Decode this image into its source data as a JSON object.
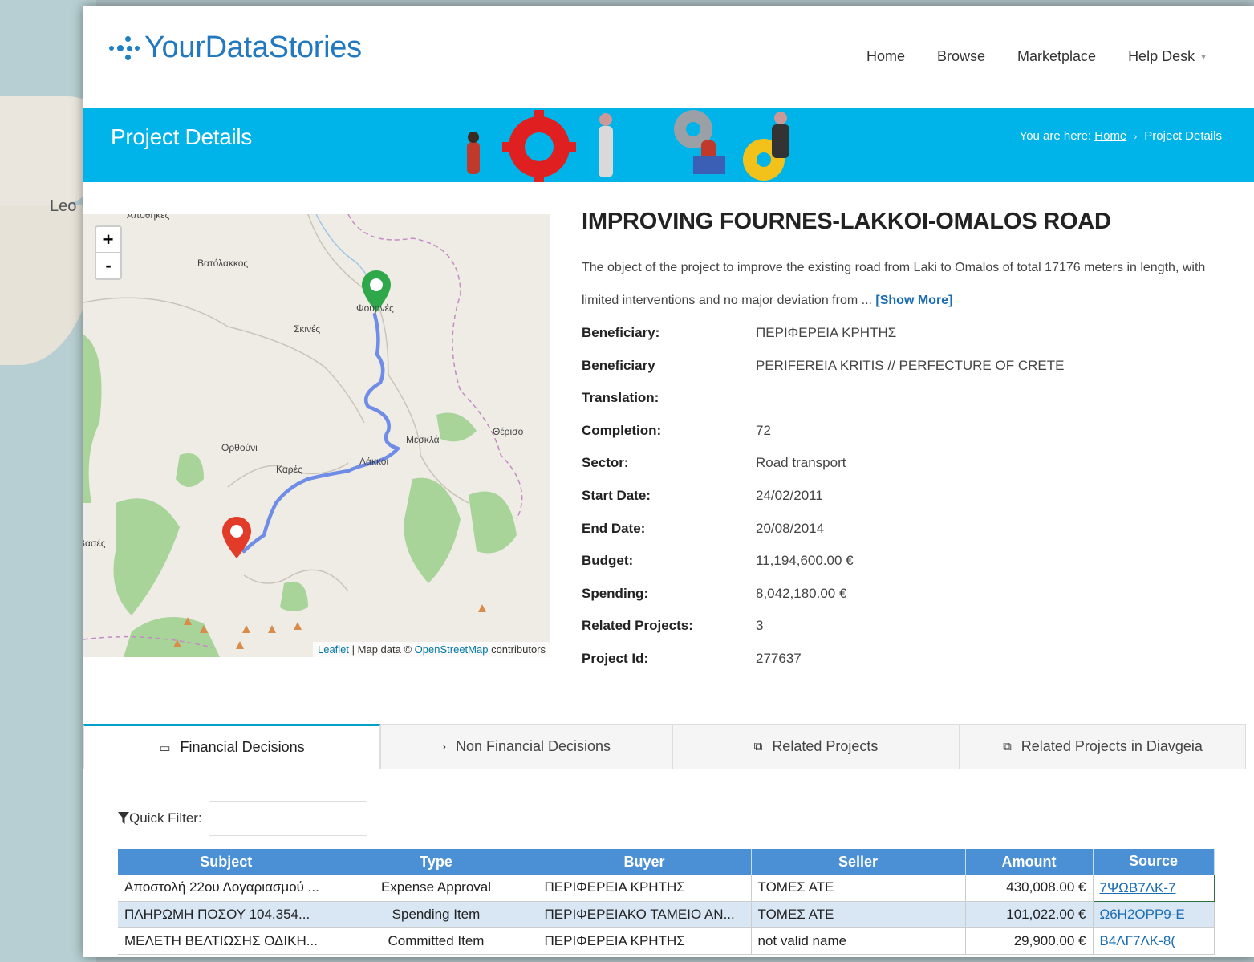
{
  "background_map": {
    "label": "Leo"
  },
  "header": {
    "logo_text": "YourDataStories",
    "nav": [
      {
        "label": "Home"
      },
      {
        "label": "Browse"
      },
      {
        "label": "Marketplace"
      },
      {
        "label": "Help Desk"
      }
    ]
  },
  "banner": {
    "title": "Project Details",
    "breadcrumb_prefix": "You are here:",
    "breadcrumb_home": "Home",
    "breadcrumb_current": "Project Details"
  },
  "map": {
    "zoom_in": "+",
    "zoom_out": "-",
    "attribution_leaflet": "Leaflet",
    "attribution_mid": "| Map data ©",
    "attribution_osm": "OpenStreetMap",
    "attribution_end": "contributors",
    "place_labels": [
      "Αποθήκες",
      "Βατόλακκος",
      "Φουρνές",
      "Σκινές",
      "Μεσκλά",
      "Θέρισο",
      "Ορθούνι",
      "Καρές",
      "Λάκκοι",
      "Βασές"
    ]
  },
  "project": {
    "title": "IMPROVING FOURNES-LAKKOI-OMALOS ROAD",
    "description": "The object of the project to improve the existing road from Laki to Omalos of total 17176 meters in length, with limited interventions and no major deviation from ...",
    "show_more": "[Show More]",
    "fields": [
      {
        "key": "Beneficiary:",
        "value": "ΠΕΡΙΦΕΡΕΙΑ ΚΡΗΤΗΣ"
      },
      {
        "key": "Beneficiary",
        "value": "PERIFEREIA KRITIS // PERFECTURE OF CRETE"
      },
      {
        "key": "Translation:",
        "value": ""
      },
      {
        "key": "Completion:",
        "value": "72"
      },
      {
        "key": "Sector:",
        "value": "Road transport"
      },
      {
        "key": "Start Date:",
        "value": "24/02/2011"
      },
      {
        "key": "End Date:",
        "value": "20/08/2014"
      },
      {
        "key": "Budget:",
        "value": "11,194,600.00 €"
      },
      {
        "key": "Spending:",
        "value": "8,042,180.00 €"
      },
      {
        "key": "Related Projects:",
        "value": "3"
      },
      {
        "key": "Project Id:",
        "value": "277637"
      }
    ]
  },
  "tabs": [
    {
      "label": "Financial Decisions",
      "icon": "card-icon",
      "glyph": "▭"
    },
    {
      "label": "Non Financial Decisions",
      "icon": "chevron-right-icon",
      "glyph": "›"
    },
    {
      "label": "Related Projects",
      "icon": "puzzle-icon",
      "glyph": "⧉"
    },
    {
      "label": "Related Projects in Diavgeia",
      "icon": "puzzle-icon",
      "glyph": "⧉"
    }
  ],
  "filter": {
    "label": "Quick Filter:",
    "value": ""
  },
  "grid": {
    "columns": [
      "Subject",
      "Type",
      "Buyer",
      "Seller",
      "Amount",
      "Source"
    ],
    "rows": [
      [
        "Αποστολή 22ου Λογαριασμού ...",
        "Expense Approval",
        "ΠΕΡΙΦΕΡΕΙΑ ΚΡΗΤΗΣ",
        "ΤΟΜΕΣ ΑΤΕ",
        "430,008.00 €",
        "7ΨΩΒ7ΛΚ-7"
      ],
      [
        "ΠΛΗΡΩΜΗ ΠΟΣΟΥ 104.354...",
        "Spending Item",
        "ΠΕΡΙΦΕΡΕΙΑΚΟ ΤΑΜΕΙΟ ΑΝ...",
        "ΤΟΜΕΣ ΑΤΕ",
        "101,022.00 €",
        "Ω6Η2ΟΡΡ9-Ε"
      ],
      [
        "ΜΕΛΕΤΗ ΒΕΛΤΙΩΣΗΣ ΟΔΙΚΗ...",
        "Committed Item",
        "ΠΕΡΙΦΕΡΕΙΑ ΚΡΗΤΗΣ",
        "not valid name",
        "29,900.00 €",
        "Β4ΛΓ7ΛΚ-8("
      ]
    ]
  },
  "colors": {
    "banner": "#00b3e8",
    "grid_header": "#4b90d5",
    "brand": "#2279bf",
    "route": "#6f8de6"
  }
}
